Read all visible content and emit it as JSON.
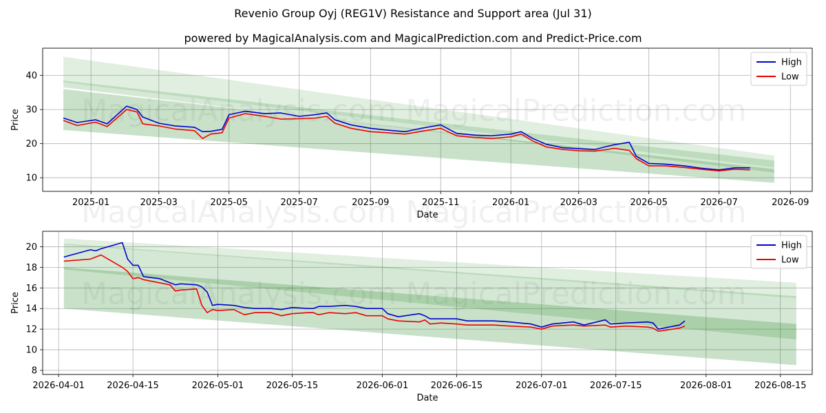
{
  "title": "Revenio Group Oyj (REG1V) Resistance and Support area (Jul 31)",
  "subtitle": "powered by MagicalAnalysis.com and MagicalPrediction.com and Predict-Price.com",
  "watermarks": [
    "MagicalAnalysis.com",
    "MagicalPrediction.com"
  ],
  "colors": {
    "high": "#0000cc",
    "low": "#ee0000",
    "band": "#2e8b2e"
  },
  "legend": {
    "high": "High",
    "low": "Low",
    "placement": "top-right"
  },
  "chart_data": [
    {
      "type": "line",
      "xlabel": "Date",
      "ylabel": "Price",
      "xlim": [
        "2024-11-20",
        "2026-09-20"
      ],
      "ylim": [
        6,
        48
      ],
      "x_ticks": [
        "2025-01",
        "2025-03",
        "2025-05",
        "2025-07",
        "2025-09",
        "2025-11",
        "2026-01",
        "2026-03",
        "2026-05",
        "2026-07",
        "2026-09"
      ],
      "y_ticks": [
        10,
        20,
        30,
        40
      ],
      "grid": true,
      "series": [
        {
          "name": "High",
          "x": [
            "2024-12-08",
            "2024-12-20",
            "2025-01-05",
            "2025-01-15",
            "2025-02-01",
            "2025-02-10",
            "2025-02-15",
            "2025-03-01",
            "2025-03-15",
            "2025-04-01",
            "2025-04-08",
            "2025-04-15",
            "2025-04-25",
            "2025-05-01",
            "2025-05-15",
            "2025-06-01",
            "2025-06-15",
            "2025-07-01",
            "2025-07-15",
            "2025-07-25",
            "2025-08-01",
            "2025-08-15",
            "2025-09-01",
            "2025-09-15",
            "2025-10-01",
            "2025-10-15",
            "2025-11-01",
            "2025-11-15",
            "2025-12-01",
            "2025-12-15",
            "2026-01-01",
            "2026-01-10",
            "2026-01-20",
            "2026-02-01",
            "2026-02-15",
            "2026-03-01",
            "2026-03-15",
            "2026-04-01",
            "2026-04-14",
            "2026-04-20",
            "2026-05-01",
            "2026-05-15",
            "2026-06-01",
            "2026-06-15",
            "2026-07-01",
            "2026-07-15",
            "2026-07-28"
          ],
          "values": [
            27.5,
            26.2,
            27.0,
            25.8,
            31.0,
            30.0,
            27.8,
            26.0,
            25.2,
            24.8,
            23.5,
            23.6,
            24.2,
            28.5,
            29.5,
            28.8,
            29.0,
            28.0,
            28.5,
            29.0,
            27.0,
            25.5,
            24.5,
            24.0,
            23.5,
            24.5,
            25.5,
            23.0,
            22.5,
            22.3,
            22.8,
            23.5,
            21.5,
            19.8,
            18.8,
            18.5,
            18.3,
            19.7,
            20.4,
            16.3,
            14.2,
            14.0,
            13.5,
            12.8,
            12.3,
            12.9,
            12.9
          ]
        },
        {
          "name": "Low",
          "x": [
            "2024-12-08",
            "2024-12-20",
            "2025-01-05",
            "2025-01-15",
            "2025-02-01",
            "2025-02-10",
            "2025-02-15",
            "2025-03-01",
            "2025-03-15",
            "2025-04-01",
            "2025-04-08",
            "2025-04-15",
            "2025-04-25",
            "2025-05-01",
            "2025-05-15",
            "2025-06-01",
            "2025-06-15",
            "2025-07-01",
            "2025-07-15",
            "2025-07-25",
            "2025-08-01",
            "2025-08-15",
            "2025-09-01",
            "2025-09-15",
            "2025-10-01",
            "2025-10-15",
            "2025-11-01",
            "2025-11-15",
            "2025-12-01",
            "2025-12-15",
            "2026-01-01",
            "2026-01-10",
            "2026-01-20",
            "2026-02-01",
            "2026-02-15",
            "2026-03-01",
            "2026-03-15",
            "2026-04-01",
            "2026-04-14",
            "2026-04-20",
            "2026-05-01",
            "2026-05-15",
            "2026-06-01",
            "2026-06-15",
            "2026-07-01",
            "2026-07-15",
            "2026-07-28"
          ],
          "values": [
            26.8,
            25.3,
            26.3,
            25.0,
            30.0,
            29.3,
            25.8,
            25.2,
            24.3,
            23.8,
            21.5,
            22.8,
            23.2,
            27.5,
            28.8,
            28.0,
            27.2,
            27.3,
            27.5,
            28.0,
            26.0,
            24.5,
            23.5,
            23.2,
            22.8,
            23.6,
            24.5,
            22.3,
            21.8,
            21.5,
            22.0,
            22.8,
            20.8,
            19.0,
            18.3,
            17.9,
            17.8,
            18.6,
            18.0,
            15.6,
            13.5,
            13.5,
            13.0,
            12.5,
            12.0,
            12.5,
            12.3
          ]
        }
      ],
      "bands": [
        {
          "x": [
            "2024-12-08",
            "2026-08-18"
          ],
          "upper": [
            45.5,
            16.5
          ],
          "lower": [
            38.0,
            13.0
          ]
        },
        {
          "x": [
            "2024-12-08",
            "2026-08-18"
          ],
          "upper": [
            38.5,
            15.0
          ],
          "lower": [
            36.5,
            11.5
          ]
        },
        {
          "x": [
            "2024-12-08",
            "2026-08-18"
          ],
          "upper": [
            36.0,
            12.5
          ],
          "lower": [
            24.0,
            8.5
          ]
        }
      ]
    },
    {
      "type": "line",
      "xlabel": "Date",
      "ylabel": "Price",
      "xlim": [
        "2026-03-29",
        "2026-08-21"
      ],
      "ylim": [
        7.6,
        21.5
      ],
      "x_ticks": [
        "2026-04-01",
        "2026-04-15",
        "2026-05-01",
        "2026-05-15",
        "2026-06-01",
        "2026-06-15",
        "2026-07-01",
        "2026-07-15",
        "2026-08-01",
        "2026-08-15"
      ],
      "y_ticks": [
        8,
        10,
        12,
        14,
        16,
        18,
        20
      ],
      "grid": true,
      "series": [
        {
          "name": "High",
          "x": [
            "2026-04-02",
            "2026-04-07",
            "2026-04-08",
            "2026-04-09",
            "2026-04-13",
            "2026-04-14",
            "2026-04-15",
            "2026-04-16",
            "2026-04-17",
            "2026-04-20",
            "2026-04-22",
            "2026-04-23",
            "2026-04-24",
            "2026-04-27",
            "2026-04-28",
            "2026-04-29",
            "2026-04-30",
            "2026-05-01",
            "2026-05-04",
            "2026-05-06",
            "2026-05-08",
            "2026-05-11",
            "2026-05-13",
            "2026-05-15",
            "2026-05-18",
            "2026-05-19",
            "2026-05-20",
            "2026-05-22",
            "2026-05-25",
            "2026-05-27",
            "2026-05-29",
            "2026-06-01",
            "2026-06-02",
            "2026-06-04",
            "2026-06-08",
            "2026-06-09",
            "2026-06-10",
            "2026-06-12",
            "2026-06-15",
            "2026-06-17",
            "2026-06-22",
            "2026-06-25",
            "2026-06-29",
            "2026-07-01",
            "2026-07-03",
            "2026-07-07",
            "2026-07-09",
            "2026-07-13",
            "2026-07-14",
            "2026-07-17",
            "2026-07-21",
            "2026-07-22",
            "2026-07-23",
            "2026-07-27",
            "2026-07-28"
          ],
          "values": [
            19.0,
            19.7,
            19.6,
            19.8,
            20.4,
            18.8,
            18.2,
            18.2,
            17.1,
            16.9,
            16.5,
            16.3,
            16.4,
            16.3,
            16.1,
            15.6,
            14.3,
            14.4,
            14.3,
            14.1,
            14.0,
            14.0,
            13.9,
            14.1,
            14.0,
            14.0,
            14.2,
            14.2,
            14.3,
            14.2,
            14.0,
            14.0,
            13.5,
            13.2,
            13.5,
            13.3,
            13.0,
            13.0,
            13.0,
            12.8,
            12.8,
            12.7,
            12.5,
            12.2,
            12.5,
            12.7,
            12.4,
            12.9,
            12.5,
            12.6,
            12.7,
            12.6,
            12.0,
            12.4,
            12.8
          ]
        },
        {
          "x": [
            "2026-04-02",
            "2026-04-07",
            "2026-04-08",
            "2026-04-09",
            "2026-04-13",
            "2026-04-14",
            "2026-04-15",
            "2026-04-16",
            "2026-04-17",
            "2026-04-20",
            "2026-04-22",
            "2026-04-23",
            "2026-04-24",
            "2026-04-27",
            "2026-04-28",
            "2026-04-29",
            "2026-04-30",
            "2026-05-01",
            "2026-05-04",
            "2026-05-06",
            "2026-05-08",
            "2026-05-11",
            "2026-05-13",
            "2026-05-15",
            "2026-05-18",
            "2026-05-19",
            "2026-05-20",
            "2026-05-22",
            "2026-05-25",
            "2026-05-27",
            "2026-05-29",
            "2026-06-01",
            "2026-06-02",
            "2026-06-04",
            "2026-06-08",
            "2026-06-09",
            "2026-06-10",
            "2026-06-12",
            "2026-06-15",
            "2026-06-17",
            "2026-06-22",
            "2026-06-25",
            "2026-06-29",
            "2026-07-01",
            "2026-07-03",
            "2026-07-07",
            "2026-07-09",
            "2026-07-13",
            "2026-07-14",
            "2026-07-17",
            "2026-07-21",
            "2026-07-22",
            "2026-07-23",
            "2026-07-27",
            "2026-07-28"
          ],
          "name": "Low",
          "values": [
            18.6,
            18.8,
            19.0,
            19.2,
            18.0,
            17.6,
            16.9,
            17.0,
            16.8,
            16.5,
            16.3,
            15.7,
            15.8,
            15.9,
            14.3,
            13.6,
            13.9,
            13.8,
            13.9,
            13.4,
            13.6,
            13.6,
            13.3,
            13.5,
            13.6,
            13.6,
            13.4,
            13.6,
            13.5,
            13.6,
            13.3,
            13.3,
            13.0,
            12.8,
            12.7,
            12.9,
            12.5,
            12.6,
            12.5,
            12.4,
            12.4,
            12.3,
            12.2,
            12.0,
            12.3,
            12.4,
            12.3,
            12.4,
            12.2,
            12.3,
            12.2,
            12.1,
            11.8,
            12.1,
            12.3
          ]
        }
      ],
      "bands": [
        {
          "x": [
            "2026-04-02",
            "2026-08-18"
          ],
          "upper": [
            20.8,
            16.5
          ],
          "lower": [
            20.2,
            15.0
          ]
        },
        {
          "x": [
            "2026-04-02",
            "2026-08-18"
          ],
          "upper": [
            20.3,
            15.2
          ],
          "lower": [
            17.8,
            11.0
          ]
        },
        {
          "x": [
            "2026-04-02",
            "2026-08-18"
          ],
          "upper": [
            18.0,
            12.5
          ],
          "lower": [
            14.0,
            8.5
          ]
        }
      ]
    }
  ]
}
